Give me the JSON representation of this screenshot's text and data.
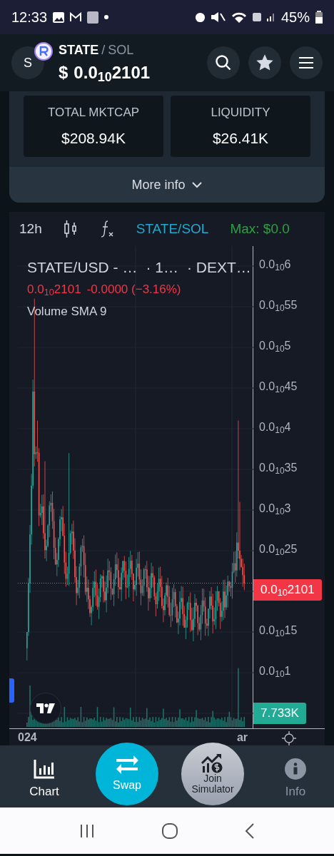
{
  "status_bar": {
    "time": "12:33",
    "battery": "45%"
  },
  "header": {
    "avatar_letter": "S",
    "base": "STATE",
    "separator": "/",
    "quote": "SOL",
    "currency": "$",
    "price": "0.0$_{10}$2101"
  },
  "stats": [
    {
      "label": "TOTAL MKTCAP",
      "value": "$208.94K"
    },
    {
      "label": "LIQUIDITY",
      "value": "$26.41K"
    }
  ],
  "more_info": {
    "label": "More info",
    "expanded": false
  },
  "chart_toolbar": {
    "interval": "12h",
    "pair": "STATE/SOL",
    "max": "Max: $0.0"
  },
  "legend": {
    "title_parts": [
      "STATE/USD - …",
      "· 1…",
      "· DEXT…"
    ],
    "price": "0.0$_{10}$2101",
    "change": "-0.0000 (−3.16%)",
    "indicator": "Volume SMA 9"
  },
  "price_axis": {
    "ticks": [
      {
        "kind": "label",
        "text": "0.0$_{10}$6"
      },
      {
        "kind": "label",
        "text": "0.0$_{10}$55"
      },
      {
        "kind": "label",
        "text": "0.0$_{10}$5"
      },
      {
        "kind": "label",
        "text": "0.0$_{10}$45"
      },
      {
        "kind": "label",
        "text": "0.0$_{10}$4"
      },
      {
        "kind": "label",
        "text": "0.0$_{10}$35"
      },
      {
        "kind": "label",
        "text": "0.0$_{10}$3"
      },
      {
        "kind": "label",
        "text": "0.0$_{10}$25"
      },
      {
        "kind": "current",
        "text": "0.0$_{10}$2101"
      },
      {
        "kind": "label",
        "text": "0.0$_{10}$15"
      },
      {
        "kind": "label",
        "text": "0.0$_{10}$1"
      }
    ],
    "volume_tag": "7.733K"
  },
  "time_axis": [
    "024",
    "ar"
  ],
  "bottom_nav": [
    {
      "kind": "tab",
      "label": "Chart",
      "selected": true
    },
    {
      "kind": "swap",
      "label": "Swap"
    },
    {
      "kind": "simulator",
      "label": "Join Simulator"
    },
    {
      "kind": "tab",
      "label": "Info",
      "selected": false
    }
  ]
}
